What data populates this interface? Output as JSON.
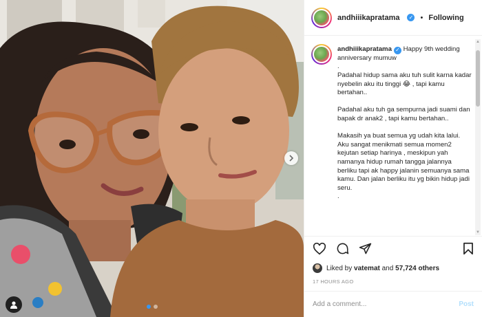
{
  "post": {
    "username": "andhiiikapratama",
    "follow_status": "Following",
    "separator": "•",
    "verified_icon": "verified-badge-icon",
    "caption_user": "andhiiikapratama",
    "caption_body": " Happy 9th wedding anniversary mumuw\n.\nPadahal hidup sama aku tuh sulit karna kadar nyebelin aku itu tinggi 😂 , tapi kamu bertahan..\n\nPadahal aku tuh ga sempurna jadi suami dan bapak dr anak2 , tapi kamu bertahan..\n\nMakasih ya buat semua yg udah kita lalui. Aku sangat menikmati semua momen2 kejutan setiap harinya , meskipun yah namanya hidup rumah tangga jalannya berliku tapi ak happy jalanin semuanya sama kamu. Dan jalan berliku itu yg bikin hidup jadi seru.\n.",
    "likes_prefix": "Liked by ",
    "likes_user": "vatemat",
    "likes_and": " and ",
    "likes_count": "57,724 others",
    "timestamp": "17 HOURS AGO",
    "comment_placeholder": "Add a comment...",
    "post_button": "Post"
  },
  "icons": {
    "like": "heart-icon",
    "comment": "comment-icon",
    "share": "share-icon",
    "save": "bookmark-icon",
    "next": "chevron-right-icon",
    "tag": "person-tag-icon"
  },
  "colors": {
    "accent_blue": "#3897f0",
    "post_button_disabled": "#b2dffc",
    "muted_text": "#8e8e8e"
  },
  "carousel": {
    "slides": 2,
    "active": 1
  }
}
